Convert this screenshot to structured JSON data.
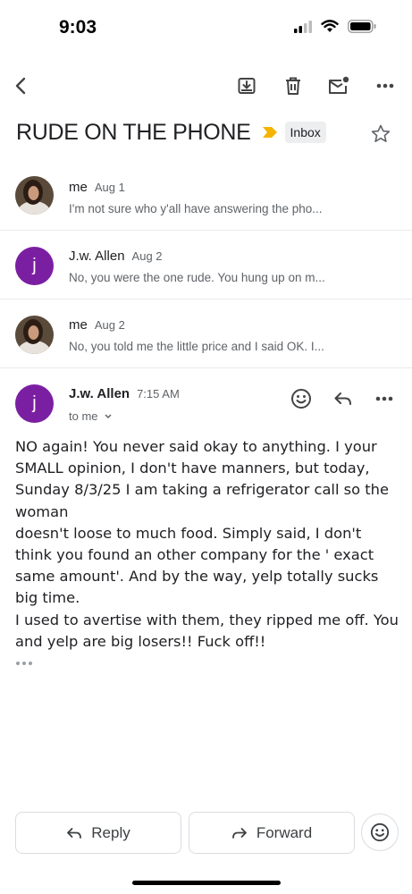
{
  "status_bar": {
    "time": "9:03"
  },
  "subject": {
    "title": "RUDE ON THE PHONE",
    "label": "Inbox"
  },
  "thread": [
    {
      "sender": "me",
      "date": "Aug 1",
      "snippet": "I'm not sure who y'all have answering the pho...",
      "avatar": "photo"
    },
    {
      "sender": "J.w. Allen",
      "date": "Aug 2",
      "snippet": "No, you were the one rude. You hung up on m...",
      "avatar": "j"
    },
    {
      "sender": "me",
      "date": "Aug 2",
      "snippet": "No, you told me the little price and I said OK. I...",
      "avatar": "photo"
    }
  ],
  "open_message": {
    "avatar_letter": "j",
    "sender": "J.w. Allen",
    "time": "7:15 AM",
    "recipient": "to me",
    "body": "NO again! You never said okay to anything. I your SMALL opinion, I don't have manners, but today, Sunday 8/3/25 I am taking a refrigerator call so the woman\ndoesn't loose to much food. Simply said, I don't think you found an other company for the ' exact same amount'. And by the way, yelp totally sucks big time.\nI used to avertise with them, they ripped me off. You and yelp are big losers!! Fuck off!!"
  },
  "actions": {
    "reply": "Reply",
    "forward": "Forward"
  },
  "colors": {
    "avatar_purple": "#7b1fa2",
    "importance_yellow": "#f4b400"
  }
}
